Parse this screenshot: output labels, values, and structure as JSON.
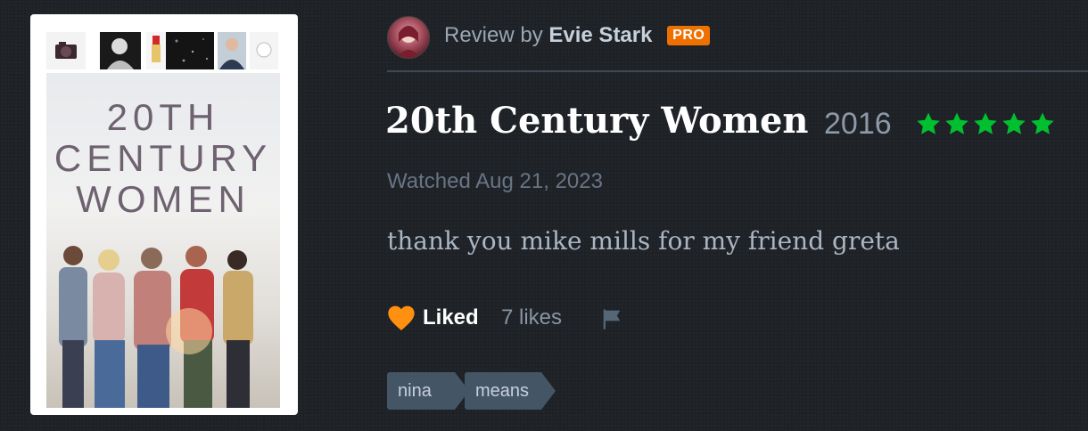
{
  "poster": {
    "title_lines": [
      "20TH",
      "CENTURY",
      "WOMEN"
    ]
  },
  "review": {
    "prefix": "Review by",
    "author": "Evie Stark",
    "badge": "PRO"
  },
  "film": {
    "title": "20th Century Women",
    "year": "2016",
    "rating_stars": 5
  },
  "watched": "Watched Aug 21, 2023",
  "body": "thank you mike mills for my friend greta",
  "actions": {
    "liked_label": "Liked",
    "likes_count": "7 likes"
  },
  "tags": [
    "nina",
    "means"
  ],
  "colors": {
    "accent_orange": "#ee7000",
    "star_green": "#00c030",
    "heart_orange": "#ff9010",
    "background": "#1e2126",
    "tag_bg": "#445566"
  },
  "icons": [
    "heart-icon",
    "star-icon",
    "flag-icon"
  ]
}
